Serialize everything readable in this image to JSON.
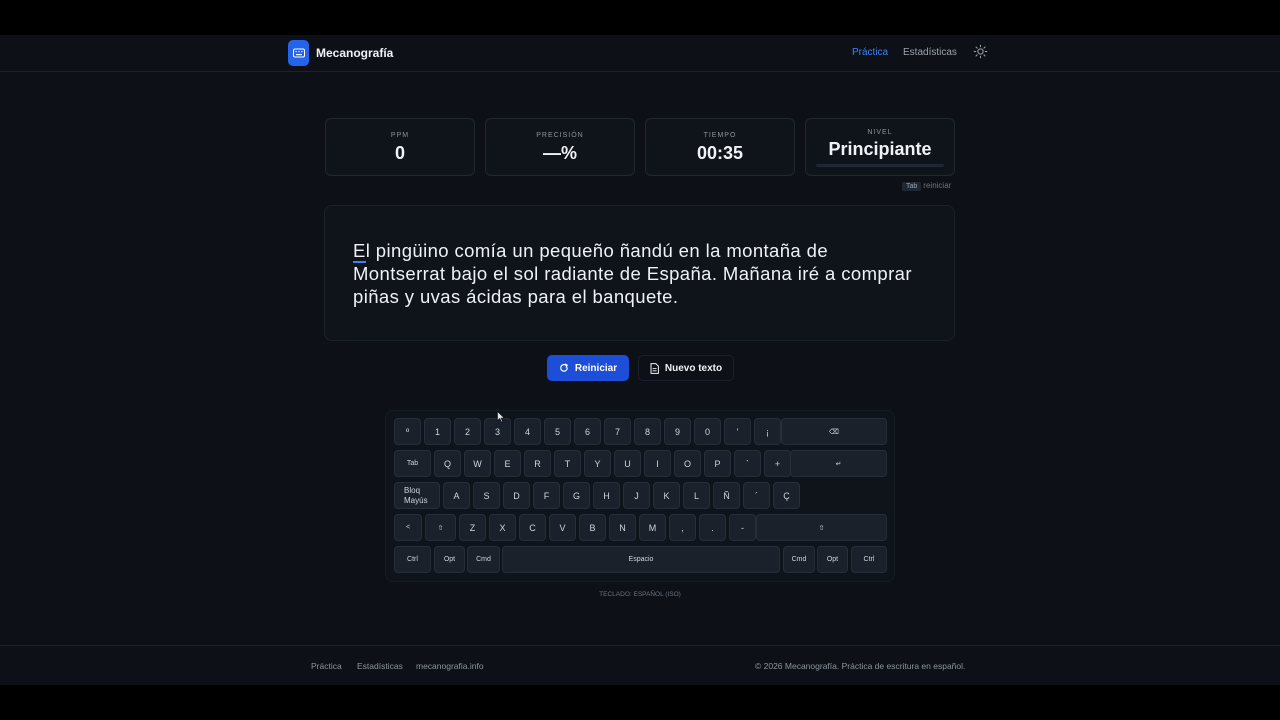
{
  "header": {
    "logo_text": "Mecanografía",
    "nav": [
      {
        "label": "Práctica",
        "active": true
      },
      {
        "label": "Estadísticas",
        "active": false
      }
    ]
  },
  "stats": {
    "ppm": {
      "label": "PPM",
      "value": "0"
    },
    "precision": {
      "label": "PRECISIÓN",
      "value": "—%"
    },
    "time": {
      "label": "TIEMPO",
      "value": "00:35"
    },
    "level": {
      "label": "NIVEL",
      "value": "Principiante",
      "progress": 0
    }
  },
  "tab_hint": {
    "key": "Tab",
    "text": "reiniciar"
  },
  "typing": {
    "first_char": "E",
    "rest": "l pingüino comía un pequeño ñandú en la montaña de Montserrat bajo el sol radiante de España. Mañana iré a comprar piñas y uvas ácidas para el banquete."
  },
  "buttons": {
    "restart": "Reiniciar",
    "new_text": "Nuevo texto"
  },
  "keyboard": {
    "rows": [
      [
        "º",
        "1",
        "2",
        "3",
        "4",
        "5",
        "6",
        "7",
        "8",
        "9",
        "0",
        "'",
        "¡",
        "⌫"
      ],
      [
        "Tab",
        "Q",
        "W",
        "E",
        "R",
        "T",
        "Y",
        "U",
        "I",
        "O",
        "P",
        "`",
        "+",
        "↵"
      ],
      [
        "Bloq\nMayús",
        "A",
        "S",
        "D",
        "F",
        "G",
        "H",
        "J",
        "K",
        "L",
        "Ñ",
        "´",
        "Ç"
      ],
      [
        "<",
        "⇧",
        "Z",
        "X",
        "C",
        "V",
        "B",
        "N",
        "M",
        ",",
        ".",
        "-",
        "⇧"
      ],
      [
        "Ctrl",
        "Opt",
        "Cmd",
        "Espacio",
        "Cmd",
        "Opt",
        "Ctrl"
      ]
    ],
    "caption": "TECLADO: ESPAÑOL (ISO)"
  },
  "footer": {
    "links": [
      "Práctica",
      "Estadísticas",
      "mecanografia.info"
    ],
    "copyright": "© 2026 Mecanografía. Práctica de escritura en español."
  },
  "colors": {
    "accent": "#2563eb",
    "background": "#0d1117",
    "card": "#0f141b"
  }
}
